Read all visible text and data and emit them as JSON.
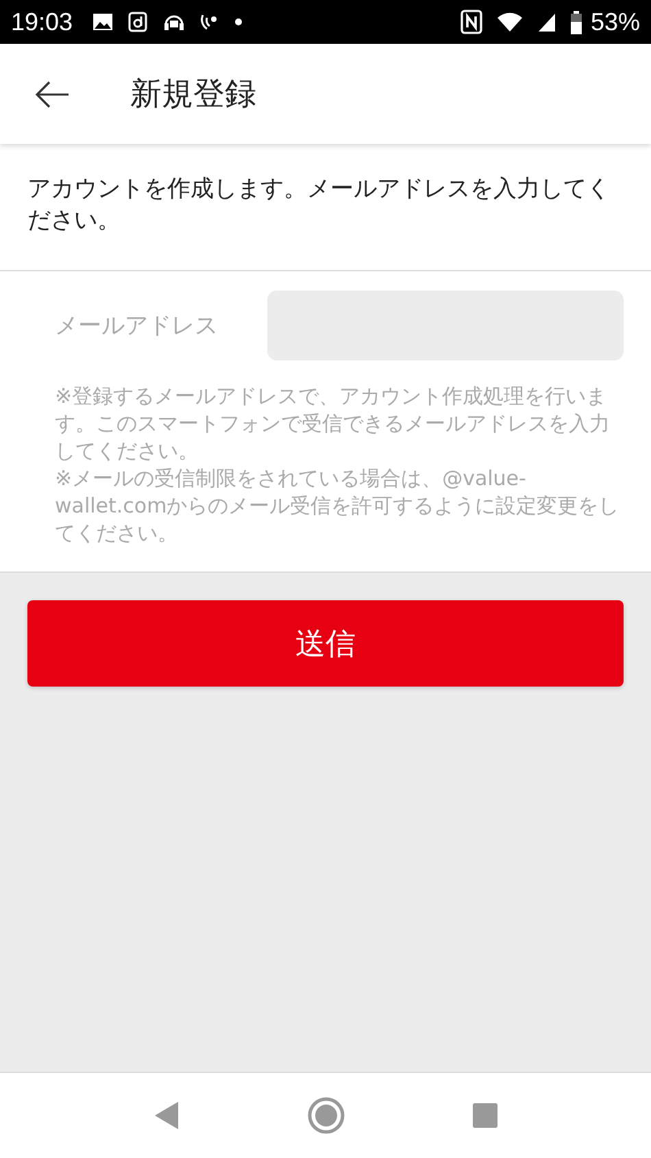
{
  "status_bar": {
    "time": "19:03",
    "battery": "53%"
  },
  "header": {
    "title": "新規登録"
  },
  "intro": "アカウントを作成します。メールアドレスを入力してください。",
  "form": {
    "label": "メールアドレス"
  },
  "notes": [
    "※登録するメールアドレスで、アカウント作成処理を行います。このスマートフォンで受信できるメールアドレスを入力してください。",
    "※メールの受信制限をされている場合は、@value-wallet.comからのメール受信を許可するように設定変更をしてください。"
  ],
  "submit_button": "送信"
}
